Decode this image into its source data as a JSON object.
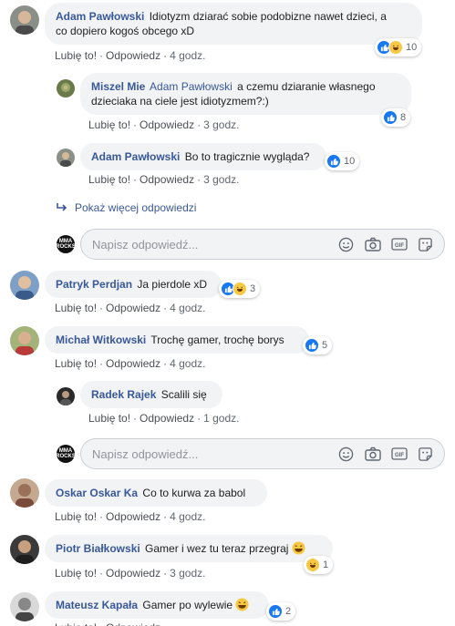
{
  "actions": {
    "like": "Lubię to!",
    "reply": "Odpowiedz",
    "dot": "·"
  },
  "reply_placeholder": "Napisz odpowiedź...",
  "show_more": "Pokaż więcej odpowiedzi",
  "logo_text": "MMA ROCKS",
  "comments": [
    {
      "author": "Adam Pawłowski",
      "text_line1": "Idiotyzm dziarać sobie podobizne nawet dzieci, a",
      "text_line2": "co dopiero kogoś obcego xD",
      "time": "4 godz.",
      "reactions": 10
    },
    {
      "author": "Miszel Mie",
      "mention": "Adam Pawłowski",
      "text_line1": "a czemu dziaranie własnego",
      "text_line2": "dzieciaka na ciele jest idiotyzmem?:)",
      "time": "3 godz.",
      "reactions": 8
    },
    {
      "author": "Adam Pawłowski",
      "text": "Bo to tragicznie wygląda?",
      "time": "3 godz.",
      "reactions": 10
    },
    {
      "author": "Patryk Perdjan",
      "text": "Ja pierdole xD",
      "time": "4 godz.",
      "reactions": 3
    },
    {
      "author": "Michał Witkowski",
      "text": "Trochę gamer, trochę borys",
      "time": "4 godz.",
      "reactions": 5
    },
    {
      "author": "Radek Rajek",
      "text": "Scalili się",
      "time": "1 godz."
    },
    {
      "author": "Oskar Oskar Ka",
      "text": "Co to kurwa za babol",
      "time": "4 godz."
    },
    {
      "author": "Piotr Białkowski",
      "text": "Gamer i wez tu teraz przegraj",
      "time": "3 godz.",
      "reactions": 1
    },
    {
      "author": "Mateusz Kapała",
      "text": "Gamer po wylewie",
      "reactions": 2
    }
  ],
  "colors": {
    "link": "#385898",
    "bubble": "#f2f3f5",
    "like": "#1877f2",
    "haha": "#f7c844"
  }
}
